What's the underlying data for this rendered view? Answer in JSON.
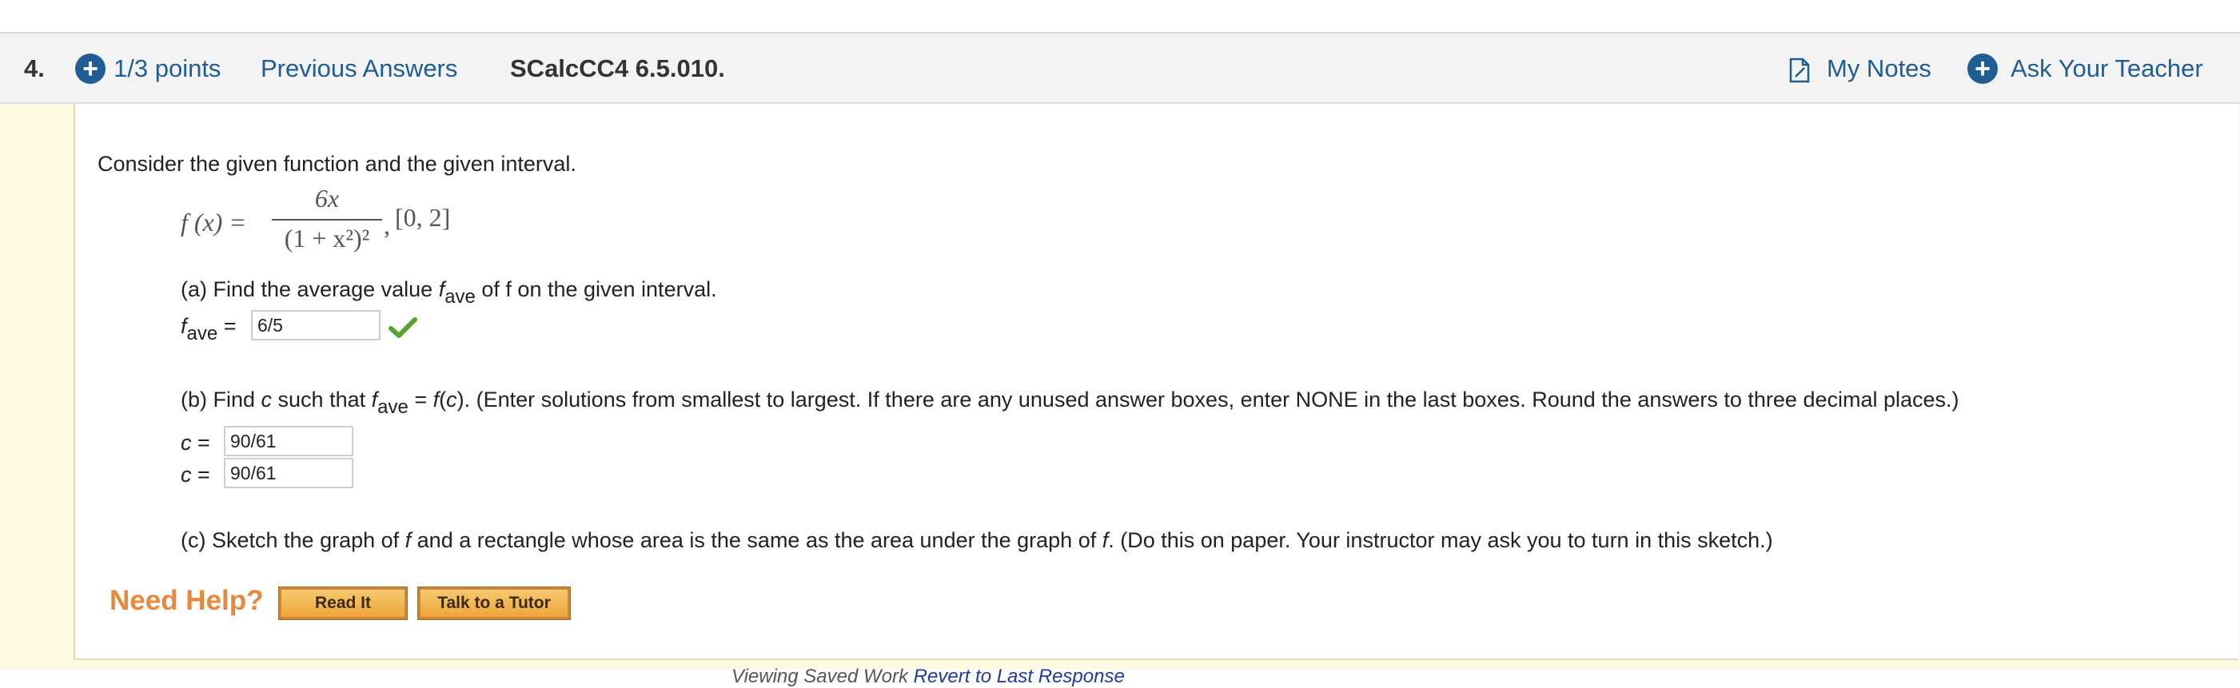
{
  "header": {
    "question_number": "4.",
    "points": "1/3 points",
    "previous_answers": "Previous Answers",
    "problem_code": "SCalcCC4 6.5.010.",
    "my_notes": "My Notes",
    "ask_teacher": "Ask Your Teacher"
  },
  "problem": {
    "intro": "Consider the given function and the given interval.",
    "function_lhs": "f (x) =",
    "numerator": "6x",
    "denominator": "(1 + x²)²",
    "interval": "[0, 2]",
    "part_a": {
      "prompt_before": "(a) Find the average value ",
      "f": "f",
      "sub": "ave",
      "prompt_after": " of f on the given interval.",
      "answer_label_f": "f",
      "answer_label_sub": "ave",
      "answer_label_eq": " = ",
      "answer_value": "6/5"
    },
    "part_b": {
      "prompt": "(b) Find c such that fave = f(c). (Enter solutions from smallest to largest. If there are any unused answer boxes, enter NONE in the last boxes. Round the answers to three decimal places.)",
      "p1": "(b) Find ",
      "c": "c",
      "p2": " such that ",
      "f": "f",
      "sub": "ave",
      "p3": " = ",
      "fc": "f",
      "p4": "(",
      "c2": "c",
      "p5": "). (Enter solutions from smallest to largest. If there are any unused answer boxes, enter NONE in the last boxes. Round the answers to three decimal places.)",
      "c_label": "c = ",
      "answers": [
        "90/61",
        "90/61"
      ]
    },
    "part_c": {
      "p1": "(c) Sketch the graph of ",
      "f1": "f",
      "p2": " and a rectangle whose area is the same as the area under the graph of ",
      "f2": "f",
      "p3": ". (Do this on paper. Your instructor may ask you to turn in this sketch.)"
    }
  },
  "help": {
    "label": "Need Help?",
    "read_it": "Read It",
    "tutor": "Talk to a Tutor"
  },
  "footer": {
    "viewing": "Viewing Saved Work ",
    "revert": "Revert to Last Response"
  },
  "colors": {
    "link": "#1f5d92",
    "help_orange": "#e8883a",
    "check_green": "#5aa02c",
    "body_yellow": "#fffbe3"
  },
  "icons": [
    "plus-circle-icon",
    "notes-icon",
    "checkmark-icon"
  ]
}
